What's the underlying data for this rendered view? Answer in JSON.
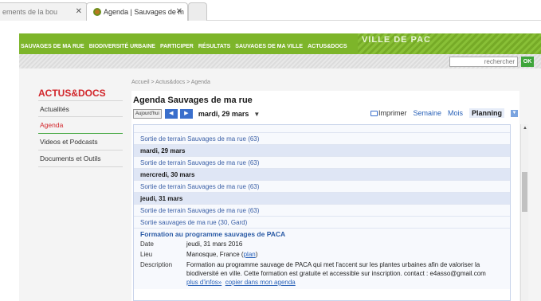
{
  "browser": {
    "tabs": [
      {
        "label": "ements de la bou"
      },
      {
        "label": "Agenda | Sauvages de m"
      },
      {
        "label": ""
      }
    ]
  },
  "site": {
    "brand": "VILLE DE PAC",
    "nav": [
      "SAUVAGES DE MA RUE",
      "BIODIVERSITÉ URBAINE",
      "PARTICIPER",
      "RÉSULTATS",
      "SAUVAGES DE MA VILLE",
      "ACTUS&DOCS"
    ],
    "search": {
      "placeholder": "rechercher",
      "button": "OK"
    }
  },
  "sidebar": {
    "title": "ACTUS&DOCS",
    "items": [
      {
        "label": "Actualités"
      },
      {
        "label": "Agenda"
      },
      {
        "label": "Videos et Podcasts"
      },
      {
        "label": "Documents et Outils"
      }
    ]
  },
  "breadcrumb": "Accueil > Actus&docs > Agenda",
  "calendar": {
    "title": "Agenda Sauvages de ma rue",
    "today_label": "Aujourd'hui",
    "current_date": "mardi, 29 mars",
    "print_label": "Imprimer",
    "views": [
      "Semaine",
      "Mois",
      "Planning"
    ],
    "rows": [
      {
        "type": "top",
        "text": ""
      },
      {
        "type": "event",
        "text": "Sortie de terrain Sauvages de ma rue (63)"
      },
      {
        "type": "day",
        "text": "mardi, 29 mars"
      },
      {
        "type": "event",
        "text": "Sortie de terrain Sauvages de ma rue (63)"
      },
      {
        "type": "day",
        "text": "mercredi, 30 mars"
      },
      {
        "type": "event",
        "text": "Sortie de terrain Sauvages de ma rue (63)"
      },
      {
        "type": "day",
        "text": "jeudi, 31 mars"
      },
      {
        "type": "event",
        "text": "Sortie de terrain Sauvages de ma rue (63)"
      },
      {
        "type": "event",
        "text": "Sortie sauvages de ma rue (30, Gard)"
      }
    ],
    "detail": {
      "title": "Formation au programme sauvages de PACA",
      "date_key": "Date",
      "date_val": "jeudi, 31 mars 2016",
      "place_key": "Lieu",
      "place_val": "Manosque, France",
      "place_link": "plan",
      "desc_key": "Description",
      "desc_val": "Formation au programme sauvage de PACA qui met l'accent sur les plantes urbaines afin de valoriser la biodiversité en ville. Cette formation est gratuite et accessible sur inscription. contact : e4asso@gmail.com",
      "more_link": "plus d'infos»",
      "copy_link": "copier dans mon agenda"
    }
  }
}
